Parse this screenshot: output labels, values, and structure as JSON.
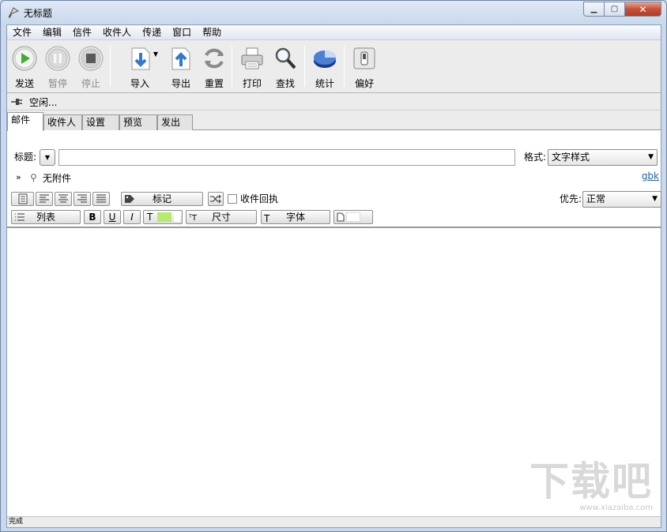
{
  "window": {
    "title": "无标题"
  },
  "menu": [
    "文件",
    "编辑",
    "信件",
    "收件人",
    "传递",
    "窗口",
    "帮助"
  ],
  "toolbar": {
    "send": "发送",
    "pause": "暂停",
    "stop": "停止",
    "import": "导入",
    "export": "导出",
    "reset": "重置",
    "print": "打印",
    "find": "查找",
    "stats": "统计",
    "prefs": "偏好"
  },
  "status": {
    "text": "空闲..."
  },
  "tabs": [
    "邮件",
    "收件人",
    "设置",
    "预览",
    "发出"
  ],
  "form": {
    "subject_label": "标题:",
    "subject_value": "",
    "format_label": "格式:",
    "format_value": "文字样式",
    "attachments": "无附件",
    "encoding": "gbk",
    "tag_label": "标记",
    "receipt_label": "收件回执",
    "priority_label": "优先:",
    "priority_value": "正常",
    "list_label": "列表",
    "bold": "B",
    "underline": "U",
    "italic": "I",
    "text_color_letter": "T",
    "size_label": "尺寸",
    "font_label": "字体"
  },
  "colors": {
    "text_color_swatch": "#b7ea6d",
    "link": "#1f5fa8"
  },
  "statusbar": {
    "text": "完成"
  },
  "watermark": {
    "text": "下载吧",
    "url": "www.xiazaiba.com"
  }
}
